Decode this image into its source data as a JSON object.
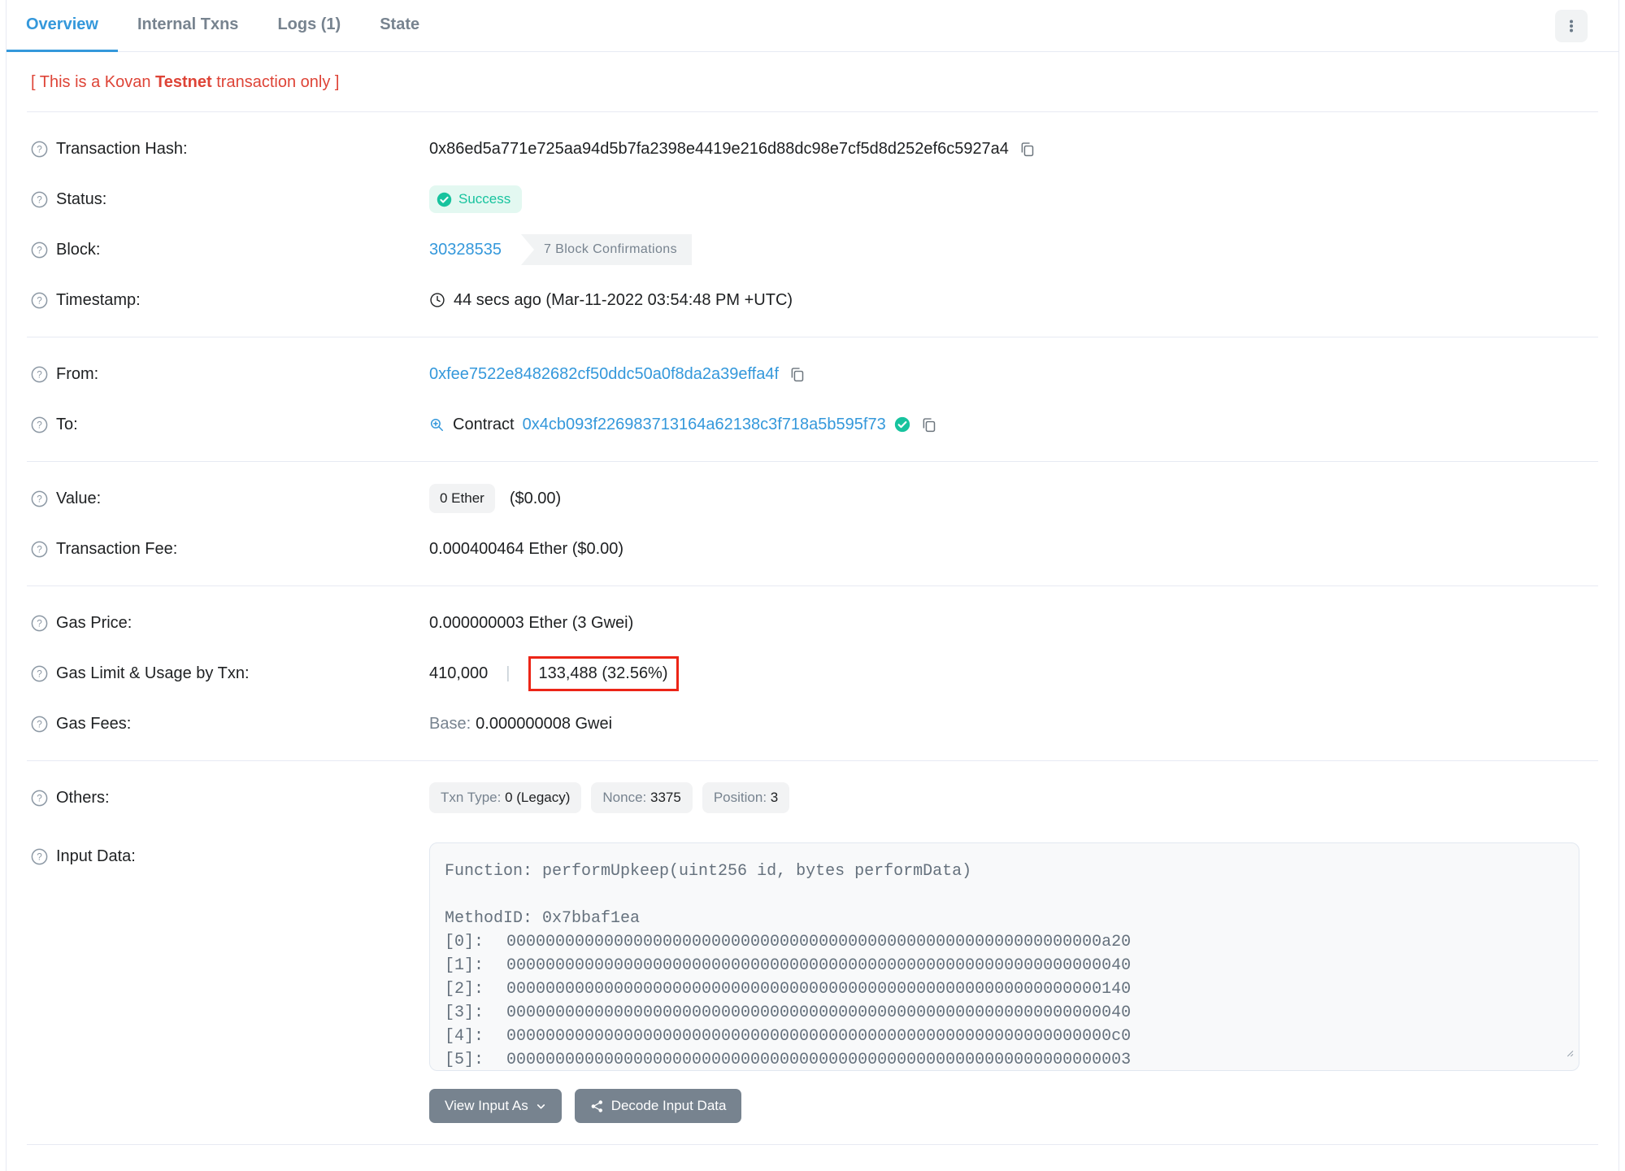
{
  "tabs": {
    "items": [
      {
        "label": "Overview",
        "active": true
      },
      {
        "label": "Internal Txns",
        "active": false
      },
      {
        "label": "Logs (1)",
        "active": false
      },
      {
        "label": "State",
        "active": false
      }
    ]
  },
  "notice": {
    "prefix": "[ This is a Kovan ",
    "bold": "Testnet",
    "suffix": " transaction only ]"
  },
  "overview": {
    "transaction_hash": {
      "label": "Transaction Hash:",
      "value": "0x86ed5a771e725aa94d5b7fa2398e4419e216d88dc98e7cf5d8d252ef6c5927a4"
    },
    "status": {
      "label": "Status:",
      "value": "Success"
    },
    "block": {
      "label": "Block:",
      "number": "30328535",
      "confirmations": "7 Block Confirmations"
    },
    "timestamp": {
      "label": "Timestamp:",
      "value": "44 secs ago (Mar-11-2022 03:54:48 PM +UTC)"
    },
    "from": {
      "label": "From:",
      "address": "0xfee7522e8482682cf50ddc50a0f8da2a39effa4f"
    },
    "to": {
      "label": "To:",
      "type": "Contract",
      "address": "0x4cb093f226983713164a62138c3f718a5b595f73"
    },
    "value": {
      "label": "Value:",
      "amount": "0 Ether",
      "usd": "($0.00)"
    },
    "transaction_fee": {
      "label": "Transaction Fee:",
      "value": "0.000400464 Ether ($0.00)"
    },
    "gas_price": {
      "label": "Gas Price:",
      "value": "0.000000003 Ether (3 Gwei)"
    },
    "gas_limit_usage": {
      "label": "Gas Limit & Usage by Txn:",
      "limit": "410,000",
      "separator": "|",
      "usage": "133,488 (32.56%)"
    },
    "gas_fees": {
      "label": "Gas Fees:",
      "base_label": "Base:",
      "base_value": "0.000000008 Gwei"
    },
    "others": {
      "label": "Others:",
      "badges": [
        {
          "name": "Txn Type:",
          "value": "0 (Legacy)"
        },
        {
          "name": "Nonce:",
          "value": "3375"
        },
        {
          "name": "Position:",
          "value": "3"
        }
      ]
    },
    "input_data": {
      "label": "Input Data:",
      "function": "Function: performUpkeep(uint256 id, bytes performData)",
      "method_id": "MethodID: 0x7bbaf1ea",
      "words": [
        {
          "index": "[0]:",
          "hex": "0000000000000000000000000000000000000000000000000000000000000a20"
        },
        {
          "index": "[1]:",
          "hex": "0000000000000000000000000000000000000000000000000000000000000040"
        },
        {
          "index": "[2]:",
          "hex": "0000000000000000000000000000000000000000000000000000000000000140"
        },
        {
          "index": "[3]:",
          "hex": "0000000000000000000000000000000000000000000000000000000000000040"
        },
        {
          "index": "[4]:",
          "hex": "00000000000000000000000000000000000000000000000000000000000000c0"
        },
        {
          "index": "[5]:",
          "hex": "0000000000000000000000000000000000000000000000000000000000000003"
        }
      ]
    }
  },
  "buttons": {
    "view_input_as": "View Input As",
    "decode_input_data": "Decode Input Data"
  },
  "icons": {
    "help": "question-circle",
    "copy": "copy",
    "clock": "clock",
    "contract_lens": "zoom-in-magnifier",
    "verified": "check-circle-filled",
    "status_check": "check-circle-filled",
    "menu": "kebab-vertical-dots",
    "caret": "chevron-down",
    "decode": "share-nodes",
    "resize": "resize-grip"
  },
  "colors": {
    "accent_blue": "#3498db",
    "success_green": "#17c39e",
    "notice_red": "#de4437",
    "annotation_red": "#ec2517",
    "text_dark": "#1e2022",
    "text_muted": "#77838f",
    "border": "#e7eaf3"
  }
}
